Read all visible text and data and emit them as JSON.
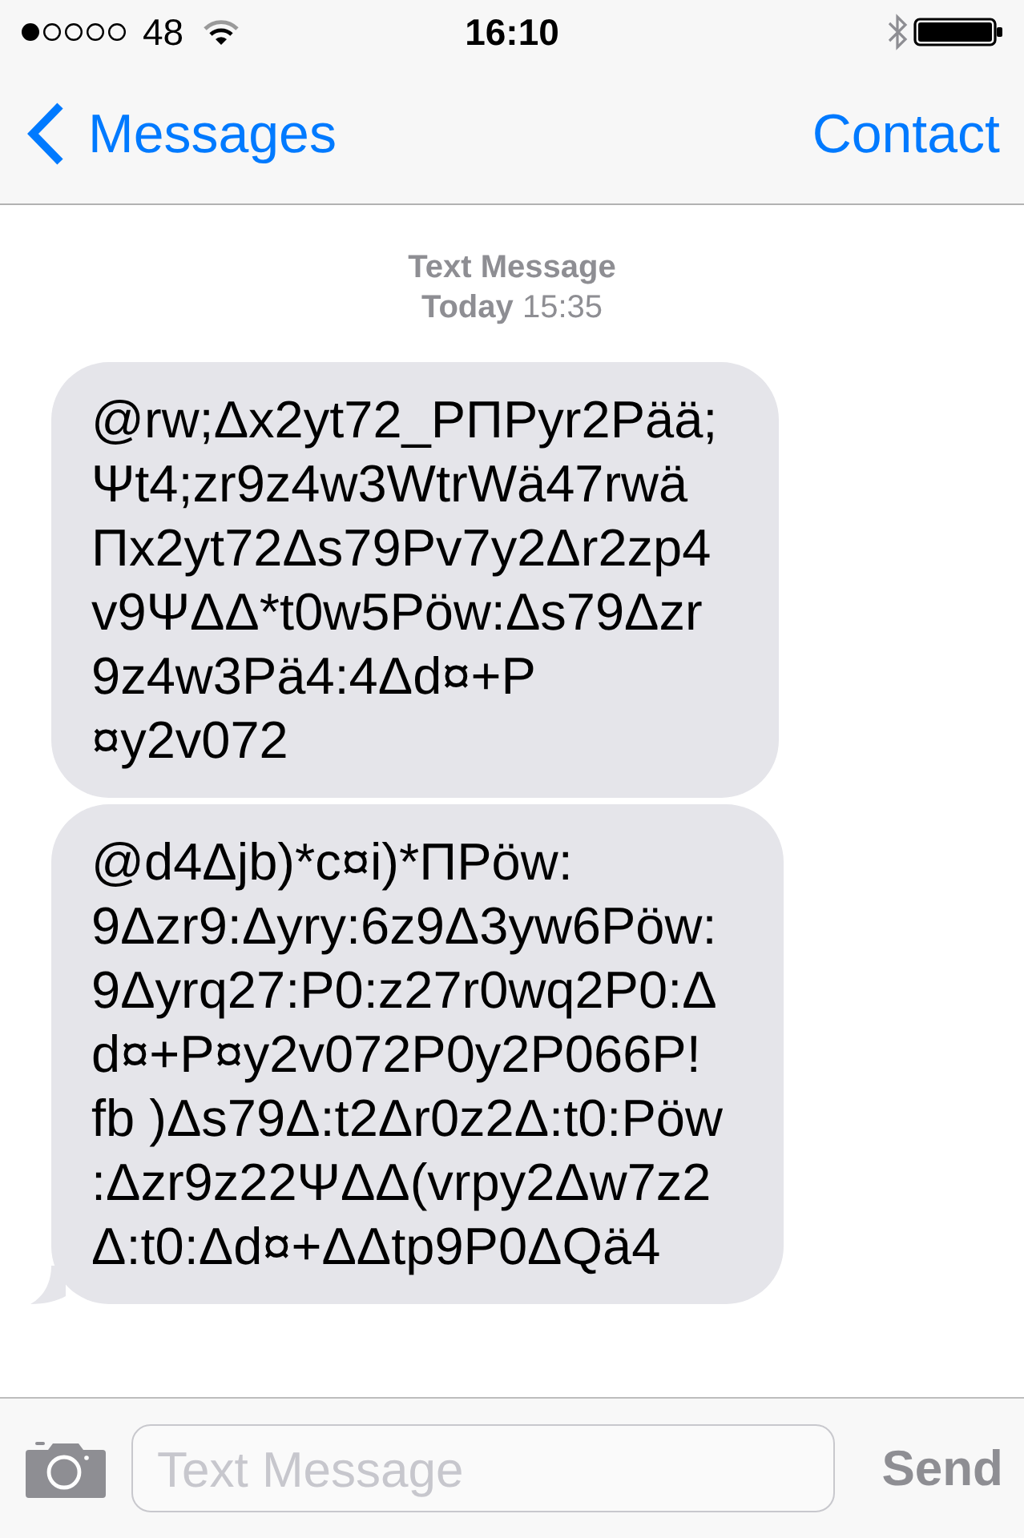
{
  "status_bar": {
    "carrier": "48",
    "time": "16:10"
  },
  "nav_bar": {
    "back": "Messages",
    "action": "Contact"
  },
  "conversation": {
    "title": "Text Message",
    "timestamp": "**Today** 15:35"
  },
  "messages": [
    {
      "text": "@rw;Δx2yt72_PΠPyr2Pää;\nΨt4;zr9z4w3WtrWä47rwä\nΠx2yt72Δs79Pv7y2Δr2zp4\nv9ΨΔΔ*t0w5Pöw:Δs79Δzr\n9z4w3Pä4:4Δd¤+P\n¤y2v072",
      "tail": false
    },
    {
      "text": "@d4Δjb)*c¤i)*ΠPöw:\n9Δzr9:Δyry:6z9Δ3yw6Pöw:\n9Δyrq27:P0:z27r0wq2P0:Δ\nd¤+P¤y2v072P0y2P066P!\nfb )Δs79Δ:t2Δr0z2Δ:t0:Pöw\n:Δzr9z22ΨΔΔ(vrpy2Δw7z2\nΔ:t0:Δd¤+ΔΔtp9P0ΔQä4",
      "tail": true
    }
  ],
  "composer": {
    "placeholder": "Text Message",
    "send": {
      "label": "Send",
      "disabled": true
    }
  }
}
